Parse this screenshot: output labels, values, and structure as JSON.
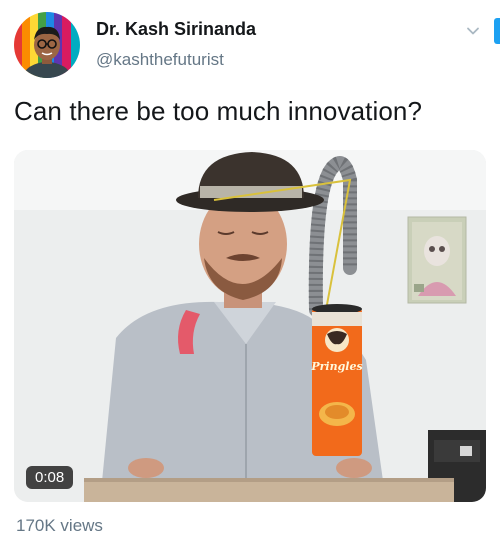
{
  "author": {
    "display_name": "Dr. Kash Sirinanda",
    "handle": "@kashthefuturist"
  },
  "tweet": {
    "text": "Can there be too much innovation?"
  },
  "video": {
    "duration": "0:08",
    "can_brand": "Pringles"
  },
  "stats": {
    "views": "170K views"
  },
  "colors": {
    "name": "#14171a",
    "secondary": "#657786",
    "accent": "#1da1f2"
  },
  "icons": {
    "more": "chevron-down-icon"
  }
}
